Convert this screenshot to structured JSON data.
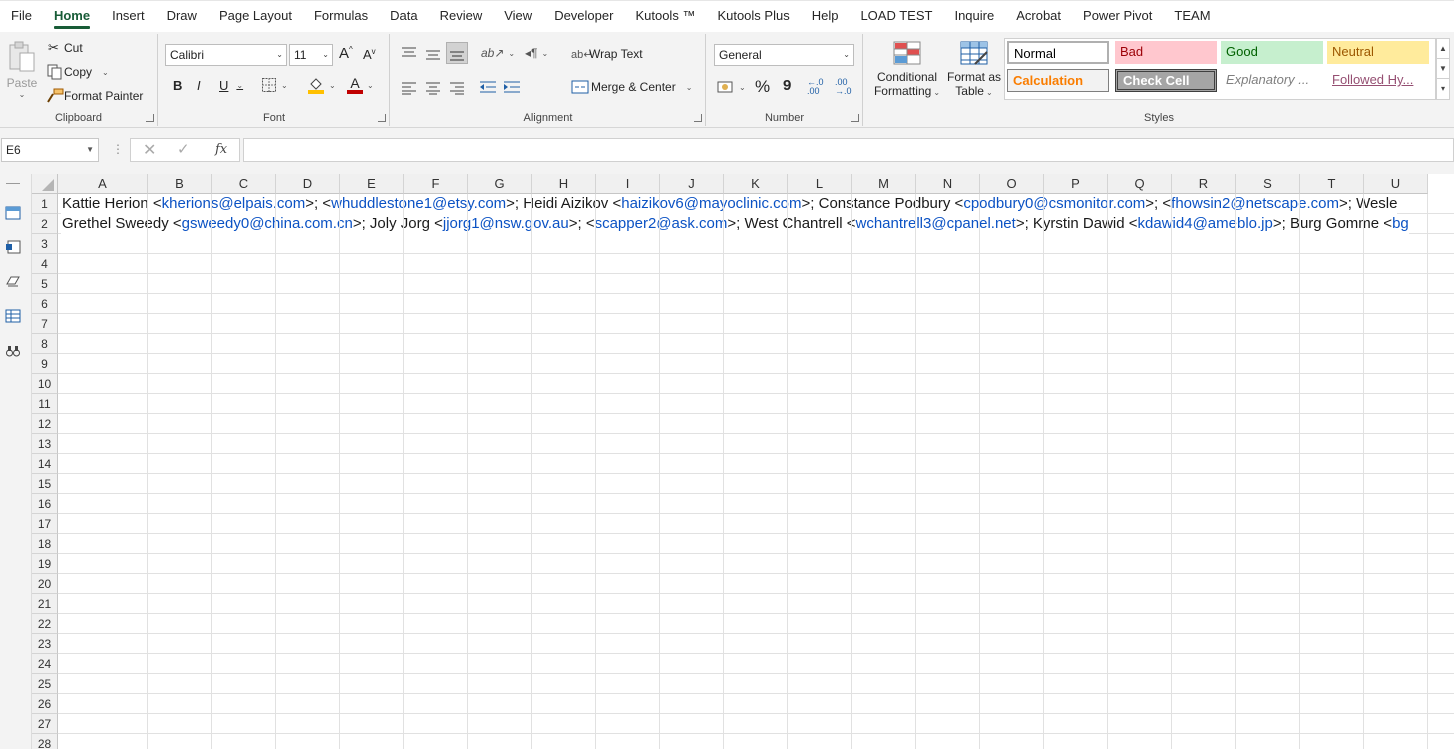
{
  "menu": {
    "tabs": [
      "File",
      "Home",
      "Insert",
      "Draw",
      "Page Layout",
      "Formulas",
      "Data",
      "Review",
      "View",
      "Developer",
      "Kutools ™",
      "Kutools Plus",
      "Help",
      "LOAD TEST",
      "Inquire",
      "Acrobat",
      "Power Pivot",
      "TEAM"
    ],
    "active": "Home"
  },
  "clipboard": {
    "label": "Clipboard",
    "paste": "Paste",
    "cut": "Cut",
    "copy": "Copy",
    "format_painter": "Format Painter"
  },
  "font": {
    "label": "Font",
    "name": "Calibri",
    "size": "11",
    "grow": "A",
    "shrink": "A",
    "bold": "B",
    "italic": "I",
    "underline": "U",
    "fill_letter": "A",
    "fill_color": "#ffc000",
    "font_color": "#c00000"
  },
  "alignment": {
    "label": "Alignment",
    "wrap_text": "Wrap Text",
    "merge_center": "Merge & Center"
  },
  "number": {
    "label": "Number",
    "format": "General",
    "percent": "%",
    "comma": "9"
  },
  "styles": {
    "label": "Styles",
    "conditional_1": "Conditional",
    "conditional_2": "Formatting",
    "format_table_1": "Format as",
    "format_table_2": "Table",
    "cells": [
      {
        "name": "Normal",
        "bg": "#ffffff",
        "color": "#000000"
      },
      {
        "name": "Bad",
        "bg": "#ffc7ce",
        "color": "#9c0006"
      },
      {
        "name": "Good",
        "bg": "#c6efce",
        "color": "#006100"
      },
      {
        "name": "Neutral",
        "bg": "#ffeb9c",
        "color": "#9c5700"
      },
      {
        "name": "Calculation",
        "bg": "#f2f2f2",
        "color": "#fa7d00"
      },
      {
        "name": "Check Cell",
        "bg": "#a5a5a5",
        "color": "#ffffff"
      },
      {
        "name": "Explanatory ...",
        "bg": "#ffffff",
        "color": "#7f7f7f"
      },
      {
        "name": "Followed Hy...",
        "bg": "#ffffff",
        "color": "#954f72"
      }
    ]
  },
  "formula_bar": {
    "name_box": "E6",
    "fx": "fx",
    "formula": ""
  },
  "sheet": {
    "columns": [
      "A",
      "B",
      "C",
      "D",
      "E",
      "F",
      "G",
      "H",
      "I",
      "J",
      "K",
      "L",
      "M",
      "N",
      "O",
      "P",
      "Q",
      "R",
      "S",
      "T",
      "U"
    ],
    "rows": [
      "1",
      "2",
      "3",
      "4",
      "5",
      "6",
      "7",
      "8",
      "9",
      "10",
      "11",
      "12",
      "13",
      "14",
      "15",
      "16",
      "17",
      "18",
      "19",
      "20",
      "21",
      "22",
      "23",
      "24",
      "25",
      "26",
      "27",
      "28"
    ],
    "row1": [
      {
        "t": "Kattie Herion <"
      },
      {
        "t": "kherions@elpais.com",
        "link": true
      },
      {
        "t": ">;  <"
      },
      {
        "t": "whuddlestone1@etsy.com",
        "link": true
      },
      {
        "t": ">; Heidi Aizikov <"
      },
      {
        "t": "haizikov6@mayoclinic.com",
        "link": true
      },
      {
        "t": ">; Constance Podbury <"
      },
      {
        "t": "cpodbury0@csmonitor.com",
        "link": true
      },
      {
        "t": ">;  <"
      },
      {
        "t": "fhowsin2@netscape.com",
        "link": true
      },
      {
        "t": ">; Wesle"
      }
    ],
    "row2": [
      {
        "t": "Grethel Sweedy <"
      },
      {
        "t": "gsweedy0@china.com.cn",
        "link": true
      },
      {
        "t": ">; Joly Jorg <"
      },
      {
        "t": "jjorg1@nsw.gov.au",
        "link": true
      },
      {
        "t": ">;  <"
      },
      {
        "t": "scapper2@ask.com",
        "link": true
      },
      {
        "t": ">; West Chantrell <"
      },
      {
        "t": "wchantrell3@cpanel.net",
        "link": true
      },
      {
        "t": ">; Kyrstin Dawid <"
      },
      {
        "t": "kdawid4@ameblo.jp",
        "link": true
      },
      {
        "t": ">; Burg Gomme <"
      },
      {
        "t": "bg",
        "link": true
      }
    ]
  }
}
